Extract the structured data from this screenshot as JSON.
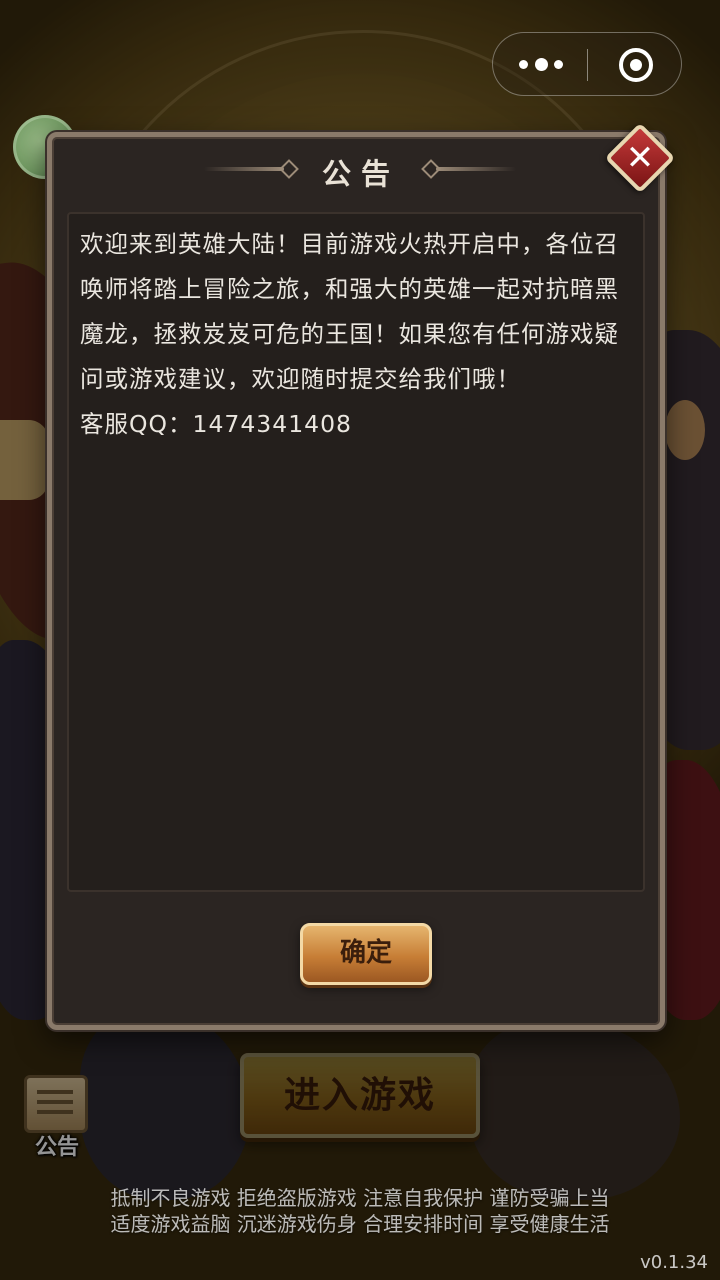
{
  "modal": {
    "title": "公告",
    "close_icon": "close-icon",
    "body": "欢迎来到英雄大陆！目前游戏火热开启中，各位召唤师将踏上冒险之旅，和强大的英雄一起对抗暗黑魔龙，拯救岌岌可危的王国！如果您有任何游戏疑问或游戏建议，欢迎随时提交给我们哦！\n客服QQ：1474341408",
    "confirm_label": "确定"
  },
  "bottom": {
    "notice_label": "公告",
    "enter_game_label": "进入游戏",
    "health_advice_line1": "抵制不良游戏 拒绝盗版游戏 注意自我保护 谨防受骗上当",
    "health_advice_line2": "适度游戏益脑 沉迷游戏伤身 合理安排时间 享受健康生活",
    "version": "v0.1.34"
  },
  "capsule": {
    "more_icon": "more-dots-icon",
    "close_icon": "target-close-icon"
  },
  "colors": {
    "modal_bg": "#2b2522",
    "confirm_button": "#c77e36",
    "enter_button": "#d79c2a",
    "close_button": "#c53a3a"
  }
}
